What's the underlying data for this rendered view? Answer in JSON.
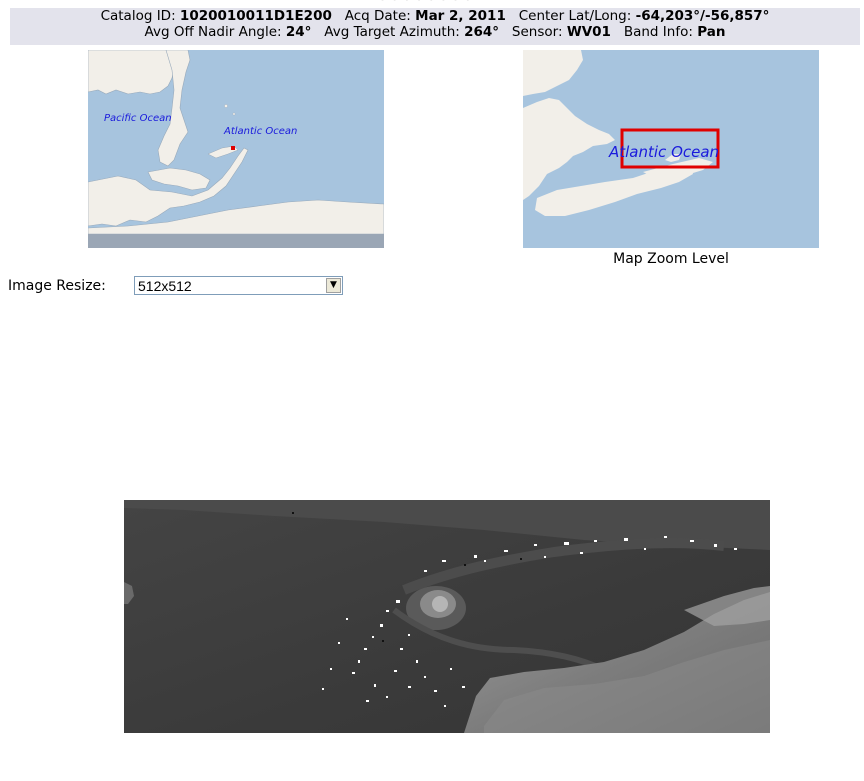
{
  "info": {
    "catalog_label": "Catalog ID:",
    "catalog_value": "1020010011D1E200",
    "acq_label": "Acq Date:",
    "acq_value": "Mar 2, 2011",
    "center_label": "Center Lat/Long:",
    "center_value": "-64,203°/-56,857°",
    "nadir_label": "Avg Off Nadir Angle:",
    "nadir_value": "24°",
    "azimuth_label": "Avg Target Azimuth:",
    "azimuth_value": "264°",
    "sensor_label": "Sensor:",
    "sensor_value": "WV01",
    "band_label": "Band Info:",
    "band_value": "Pan"
  },
  "overview_map": {
    "label_pacific": "Pacific Ocean",
    "label_atlantic": "Atlantic Ocean"
  },
  "zoom_map": {
    "label_atlantic": "Atlantic Ocean",
    "caption": "Map Zoom Level",
    "highlight_color": "#e00000"
  },
  "resize": {
    "label": "Image Resize:",
    "selected": "512x512"
  },
  "colors": {
    "ocean": "#a7c4de",
    "land": "#f2efe9",
    "info_bg": "#e3e3ec",
    "map_label": "#1a1adc"
  }
}
